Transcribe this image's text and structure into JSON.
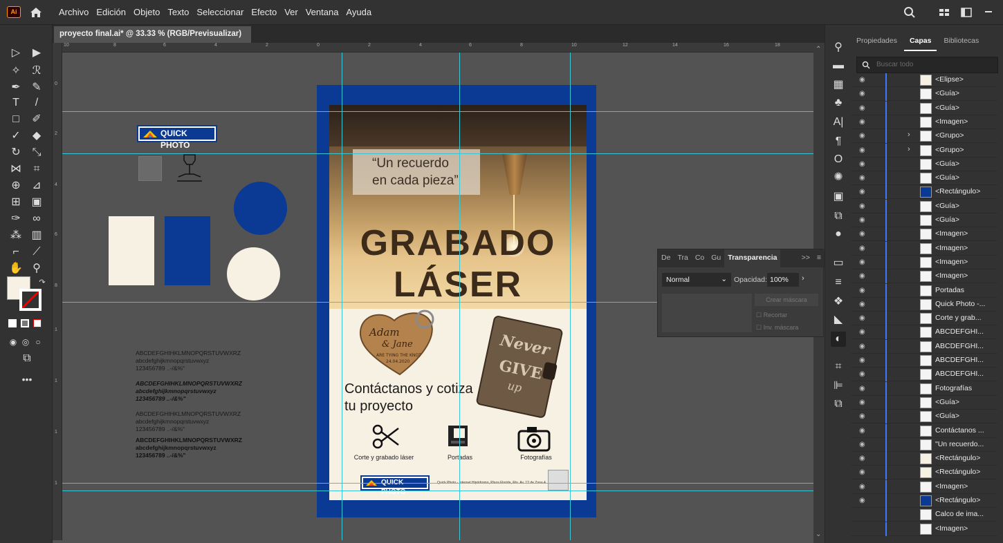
{
  "app": {
    "logo": "Ai",
    "menu": [
      "Archivo",
      "Edición",
      "Objeto",
      "Texto",
      "Seleccionar",
      "Efecto",
      "Ver",
      "Ventana",
      "Ayuda"
    ]
  },
  "document": {
    "tab_title": "proyecto final.ai* @ 33.33 % (RGB/Previsualizar)",
    "close": "×"
  },
  "rulers": {
    "h_ticks": [
      "10",
      "8",
      "6",
      "4",
      "2",
      "0",
      "2",
      "4",
      "6",
      "8",
      "10",
      "12",
      "14",
      "16",
      "18"
    ],
    "v_ticks": [
      "0",
      "2",
      "4",
      "6",
      "8",
      "1",
      "1",
      "1",
      "1"
    ]
  },
  "artwork": {
    "logo_text": "QUICK PHOTO",
    "quote_line1": "“Un recuerdo",
    "quote_line2": "en cada pieza”",
    "title1": "GRABADO",
    "title2": "LÁSER",
    "contact_line1": "Contáctanos y cotiza",
    "contact_line2": "tu proyecto",
    "icon1_label": "Corte y grabado láser",
    "icon2_label": "Portadas",
    "icon3_label": "Fotografías",
    "footer_small": "Quick Photo - Internet Hipódromo, Plaza Florida, Rio. Av. 12 de Zona 4",
    "tag_text1": "Adam",
    "tag_text2": "& Jane",
    "tag_text3": "ARE TYING THE KNOT",
    "tag_text4": "24.04.2020",
    "notebook_text1": "Never",
    "notebook_text2": "GIVE",
    "notebook_text3": "up"
  },
  "specimens": [
    {
      "line1": "ABCDEFGHIHKLMNOPQRSTUVWXRZ",
      "line2": "abcdefghijkmnopqrstuvwxyz",
      "line3": "123456789 ..-/&%\""
    },
    {
      "line1": "ABCDEFGHIHKLMNOPQRSTUVWXRZ",
      "line2": "abcdefghijkmnopqrstuvwxyz",
      "line3": "123456789 ..-/&%\""
    },
    {
      "line1": "ABCDEFGHIHKLMNOPQRSTUVWXRZ",
      "line2": "abcdefghijkmnopqrstuvwxyz",
      "line3": "123456789 ..-/&%\""
    },
    {
      "line1": "ABCDEFGHIHKLMNOPQRSTUVWXRZ",
      "line2": "abcdefghijkmnopqrstuvwxyz",
      "line3": "123456789 ..-/&%\""
    }
  ],
  "transparency_panel": {
    "tabs": [
      "De",
      "Tra",
      "Co",
      "Gu",
      "Transparencia"
    ],
    "blend_mode": "Normal",
    "opacity_label": "Opacidad:",
    "opacity_value": "100%",
    "make_mask": "Crear máscara",
    "clip": "Recortar",
    "invert": "Inv. máscara",
    "more": ">>"
  },
  "layers_panel": {
    "tabs": [
      "Propiedades",
      "Capas",
      "Bibliotecas"
    ],
    "search_placeholder": "Buscar todo",
    "rows": [
      {
        "name": "<Elipse>",
        "thumb": "cream",
        "chev": ""
      },
      {
        "name": "<Guía>",
        "thumb": "white",
        "chev": ""
      },
      {
        "name": "<Guía>",
        "thumb": "white",
        "chev": ""
      },
      {
        "name": "<Imagen>",
        "thumb": "white",
        "chev": ""
      },
      {
        "name": "<Grupo>",
        "thumb": "white",
        "chev": "›"
      },
      {
        "name": "<Grupo>",
        "thumb": "white",
        "chev": "›"
      },
      {
        "name": "<Guía>",
        "thumb": "white",
        "chev": ""
      },
      {
        "name": "<Guía>",
        "thumb": "white",
        "chev": ""
      },
      {
        "name": "<Rectángulo>",
        "thumb": "blue",
        "chev": ""
      },
      {
        "name": "<Guía>",
        "thumb": "white",
        "chev": ""
      },
      {
        "name": "<Guía>",
        "thumb": "white",
        "chev": ""
      },
      {
        "name": "<Imagen>",
        "thumb": "white",
        "chev": ""
      },
      {
        "name": "<Imagen>",
        "thumb": "white",
        "chev": ""
      },
      {
        "name": "<Imagen>",
        "thumb": "white",
        "chev": ""
      },
      {
        "name": "<Imagen>",
        "thumb": "white",
        "chev": ""
      },
      {
        "name": "Portadas",
        "thumb": "white",
        "chev": ""
      },
      {
        "name": "Quick Photo -...",
        "thumb": "white",
        "chev": ""
      },
      {
        "name": "Corte y grab...",
        "thumb": "white",
        "chev": ""
      },
      {
        "name": "ABCDEFGHI...",
        "thumb": "white",
        "chev": ""
      },
      {
        "name": "ABCDEFGHI...",
        "thumb": "white",
        "chev": ""
      },
      {
        "name": "ABCDEFGHI...",
        "thumb": "white",
        "chev": ""
      },
      {
        "name": "ABCDEFGHI...",
        "thumb": "white",
        "chev": ""
      },
      {
        "name": "Fotografías",
        "thumb": "white",
        "chev": ""
      },
      {
        "name": "<Guía>",
        "thumb": "white",
        "chev": ""
      },
      {
        "name": "<Guía>",
        "thumb": "white",
        "chev": ""
      },
      {
        "name": "Contáctanos ...",
        "thumb": "white",
        "chev": ""
      },
      {
        "name": "\"Un recuerdo...",
        "thumb": "white",
        "chev": ""
      },
      {
        "name": "<Rectángulo>",
        "thumb": "cream",
        "chev": ""
      },
      {
        "name": "<Rectángulo>",
        "thumb": "cream",
        "chev": ""
      },
      {
        "name": "<Imagen>",
        "thumb": "white",
        "chev": ""
      },
      {
        "name": "<Rectángulo>",
        "thumb": "blue",
        "chev": ""
      },
      {
        "name": "Calco de ima...",
        "thumb": "white",
        "chev": ""
      },
      {
        "name": "<Imagen>",
        "thumb": "white",
        "chev": ""
      }
    ]
  },
  "colors": {
    "brand_blue": "#0b3a94",
    "cream": "#f7f1e3",
    "guide": "#39c6d6",
    "layer_bar": "#3d79ff"
  }
}
